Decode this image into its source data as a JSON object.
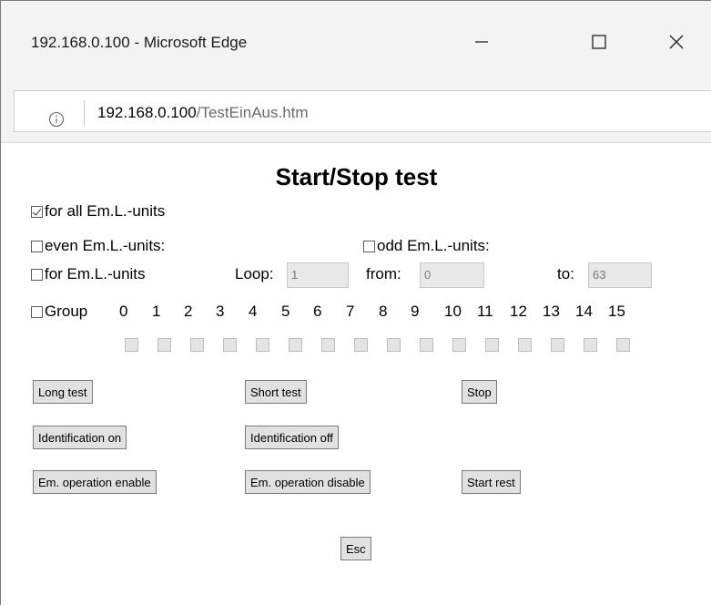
{
  "window": {
    "title": "192.168.0.100 - Microsoft Edge",
    "controls": {
      "minimize": "—",
      "maximize": "☐",
      "close": "✕"
    }
  },
  "address": {
    "host": "192.168.0.100",
    "path": "/TestEinAus.htm"
  },
  "page": {
    "heading": "Start/Stop test",
    "all_units": {
      "label": "for all Em.L.-units",
      "checked": true
    },
    "even_units": {
      "label": "even Em.L.-units:",
      "checked": false
    },
    "odd_units": {
      "label": "odd Em.L.-units:",
      "checked": false
    },
    "for_units": {
      "label": "for Em.L.-units",
      "checked": false
    },
    "loop": {
      "label": "Loop:",
      "value": "1"
    },
    "from": {
      "label": "from:",
      "value": "0"
    },
    "to": {
      "label": "to:",
      "value": "63"
    },
    "group": {
      "label": "Group",
      "checked": false,
      "numbers": [
        "0",
        "1",
        "2",
        "3",
        "4",
        "5",
        "6",
        "7",
        "8",
        "9",
        "10",
        "11",
        "12",
        "13",
        "14",
        "15"
      ]
    },
    "buttons": {
      "long_test": "Long test",
      "short_test": "Short test",
      "stop": "Stop",
      "ident_on": "Identification on",
      "ident_off": "Identification off",
      "em_enable": "Em. operation enable",
      "em_disable": "Em. operation disable",
      "start_rest": "Start rest",
      "esc": "Esc"
    }
  }
}
